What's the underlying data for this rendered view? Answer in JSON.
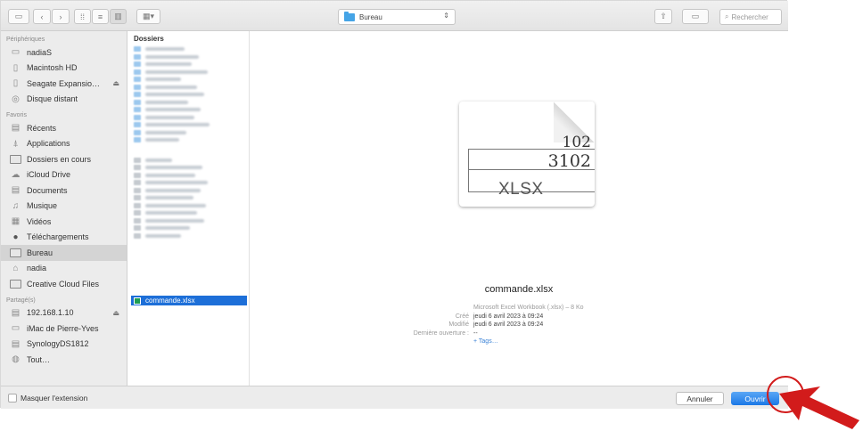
{
  "toolbar": {
    "location": "Bureau",
    "search_placeholder": "Rechercher"
  },
  "sidebar": {
    "sections": [
      {
        "title": "Périphériques",
        "items": [
          {
            "label": "nadiaS",
            "icon": "laptop-icon"
          },
          {
            "label": "Macintosh HD",
            "icon": "hard-drive-icon"
          },
          {
            "label": "Seagate Expansio…",
            "icon": "external-drive-icon",
            "eject": true
          },
          {
            "label": "Disque distant",
            "icon": "disc-icon"
          }
        ]
      },
      {
        "title": "Favoris",
        "items": [
          {
            "label": "Récents",
            "icon": "recents-icon"
          },
          {
            "label": "Applications",
            "icon": "applications-icon"
          },
          {
            "label": "Dossiers en cours",
            "icon": "folder-icon"
          },
          {
            "label": "iCloud Drive",
            "icon": "cloud-icon"
          },
          {
            "label": "Documents",
            "icon": "documents-icon"
          },
          {
            "label": "Musique",
            "icon": "music-icon"
          },
          {
            "label": "Vidéos",
            "icon": "video-icon"
          },
          {
            "label": "Téléchargements",
            "icon": "downloads-icon"
          },
          {
            "label": "Bureau",
            "icon": "desktop-icon",
            "selected": true
          },
          {
            "label": "nadia",
            "icon": "home-icon"
          },
          {
            "label": "Creative Cloud Files",
            "icon": "folder-icon"
          }
        ]
      },
      {
        "title": "Partagé(s)",
        "items": [
          {
            "label": "192.168.1.10",
            "icon": "server-icon",
            "eject": true
          },
          {
            "label": "iMac de Pierre-Yves",
            "icon": "imac-icon"
          },
          {
            "label": "SynologyDS1812",
            "icon": "nas-icon"
          },
          {
            "label": "Tout…",
            "icon": "network-icon"
          }
        ]
      }
    ]
  },
  "column": {
    "title": "Dossiers",
    "selected_file": "commande.xlsx"
  },
  "preview": {
    "thumb_numbers": [
      "102",
      "3102"
    ],
    "thumb_ext": "XLSX",
    "filename": "commande.xlsx",
    "meta": [
      {
        "key": "",
        "value": "Microsoft Excel Workbook (.xlsx) – 8 Ko",
        "style": "soft"
      },
      {
        "key": "Créé",
        "value": "jeudi 6 avril 2023 à 09:24",
        "style": ""
      },
      {
        "key": "Modifié",
        "value": "jeudi 6 avril 2023 à 09:24",
        "style": ""
      },
      {
        "key": "Dernière ouverture :",
        "value": "--",
        "style": ""
      },
      {
        "key": "",
        "value": "+ Tags…",
        "style": "link"
      }
    ]
  },
  "footer": {
    "hide_extension_label": "Masquer l'extension",
    "cancel_label": "Annuler",
    "open_label": "Ouvrir"
  },
  "colors": {
    "accent": "#1b78e6",
    "annotation": "#d21b1b"
  }
}
